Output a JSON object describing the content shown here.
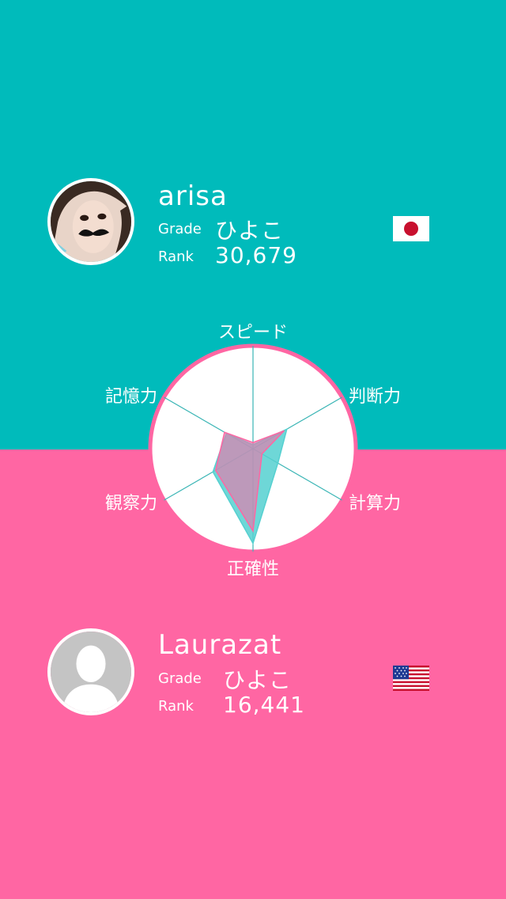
{
  "players": [
    {
      "name": "arisa",
      "grade_label": "Grade",
      "grade": "ひよこ",
      "rank_label": "Rank",
      "rank": "30,679",
      "avatar": "photo-avatar-icon",
      "flag": "japan-flag-icon"
    },
    {
      "name": "Laurazat",
      "grade_label": "Grade",
      "grade": "ひよこ",
      "rank_label": "Rank",
      "rank": "16,441",
      "avatar": "default-user-avatar-icon",
      "flag": "usa-flag-icon"
    }
  ],
  "radar": {
    "axes": [
      "スピード",
      "判断力",
      "計算力",
      "正確性",
      "観察力",
      "記憶力"
    ],
    "series": [
      {
        "player": "arisa",
        "color": "#FF66A3",
        "values": [
          0.06,
          0.35,
          0.1,
          0.8,
          0.42,
          0.32
        ]
      },
      {
        "player": "Laurazat",
        "color": "#55D0D0",
        "values": [
          0.04,
          0.38,
          0.28,
          0.92,
          0.45,
          0.3
        ]
      }
    ]
  },
  "colors": {
    "top_panel": "#00BBBB",
    "bottom_panel": "#FF66A3",
    "overlap": "#6FA3C2"
  }
}
